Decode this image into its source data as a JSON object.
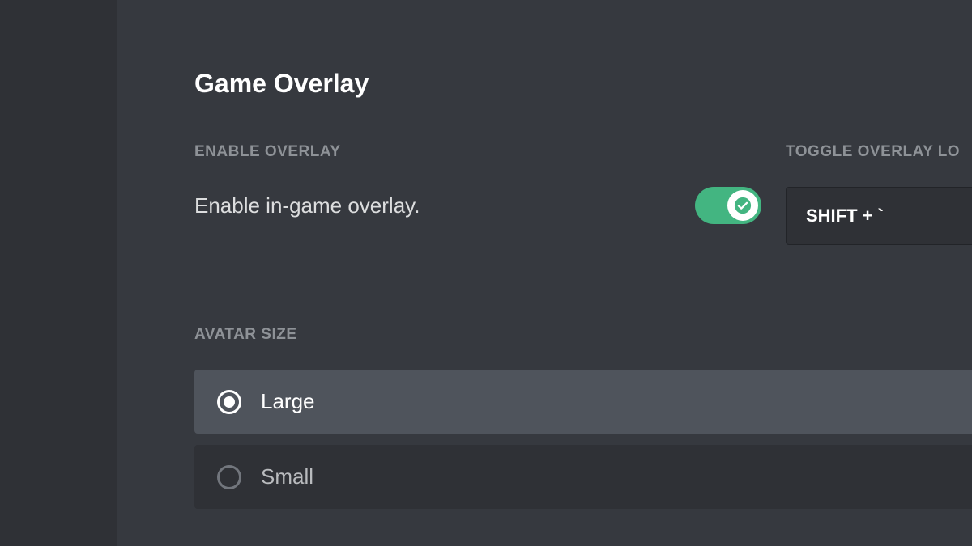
{
  "page": {
    "title": "Game Overlay"
  },
  "enableSection": {
    "label": "ENABLE OVERLAY",
    "description": "Enable in-game overlay.",
    "toggleOn": true
  },
  "keybindSection": {
    "label": "TOGGLE OVERLAY LO",
    "value": "SHIFT + `"
  },
  "avatarSection": {
    "label": "AVATAR SIZE",
    "options": [
      {
        "label": "Large",
        "selected": true
      },
      {
        "label": "Small",
        "selected": false
      }
    ]
  }
}
